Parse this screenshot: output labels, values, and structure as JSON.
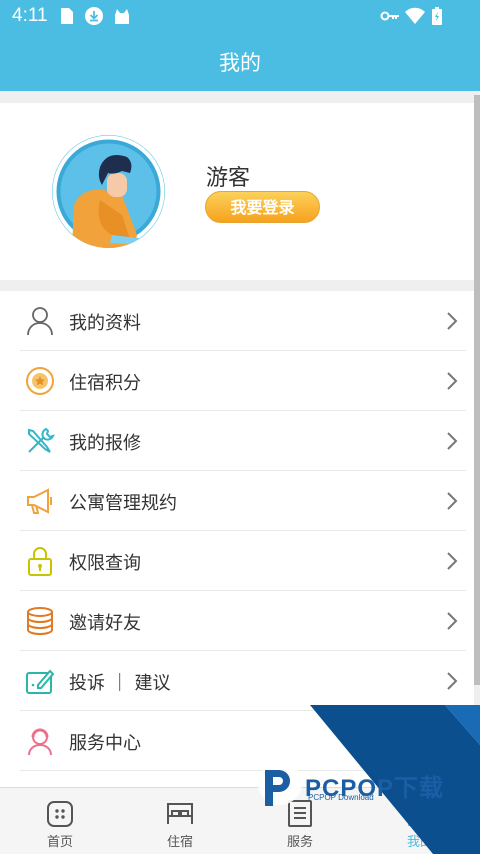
{
  "status_bar": {
    "time": "4:11"
  },
  "header": {
    "title": "我的"
  },
  "profile": {
    "username": "游客",
    "login_label": "我要登录"
  },
  "menu": {
    "items": [
      {
        "label": "我的资料",
        "icon": "user-icon"
      },
      {
        "label": "住宿积分",
        "icon": "medal-icon"
      },
      {
        "label": "我的报修",
        "icon": "tools-icon"
      },
      {
        "label": "公寓管理规约",
        "icon": "megaphone-icon"
      },
      {
        "label": "权限查询",
        "icon": "lock-icon"
      },
      {
        "label": "邀请好友",
        "icon": "coins-icon"
      },
      {
        "label": "投诉 ｜ 建议",
        "icon": "feedback-icon"
      },
      {
        "label": "服务中心",
        "icon": "service-icon"
      }
    ]
  },
  "tabbar": {
    "tabs": [
      {
        "label": "首页",
        "icon": "home-icon"
      },
      {
        "label": "住宿",
        "icon": "bed-icon"
      },
      {
        "label": "服务",
        "icon": "service-doc-icon"
      },
      {
        "label": "我的",
        "icon": "profile-icon",
        "active": true
      }
    ]
  },
  "watermark": {
    "brand": "PCPOP下载",
    "sub": "PCPOP Download"
  },
  "colors": {
    "brand": "#4bbde2",
    "login_button": "#f6a21e",
    "watermark": "#1b5ea3"
  }
}
